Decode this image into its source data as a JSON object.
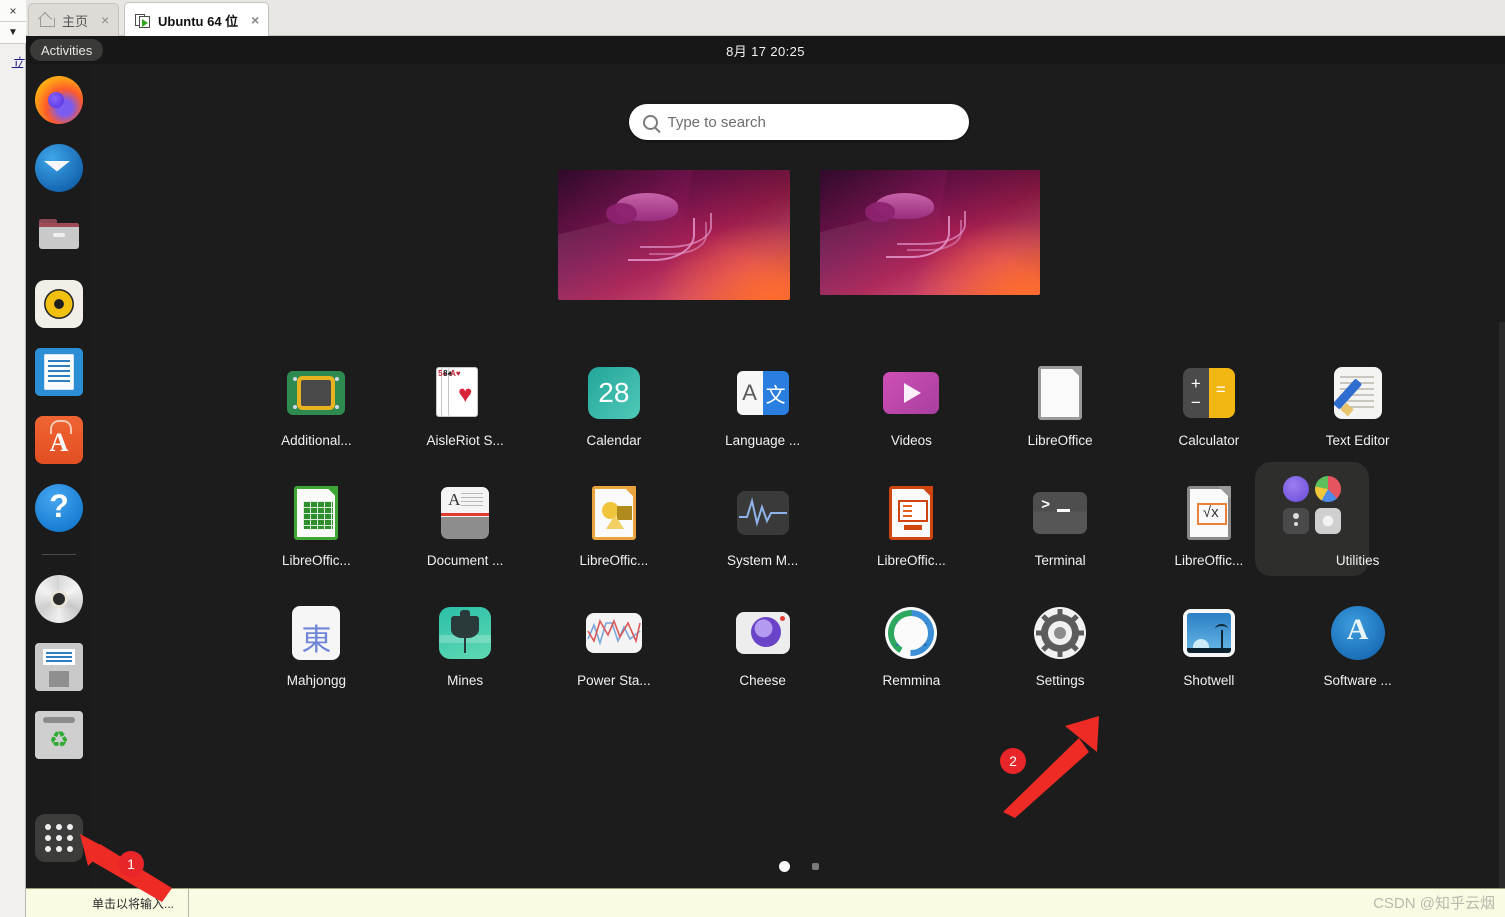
{
  "vmware": {
    "tabs": [
      {
        "label": "主页",
        "icon": "home-icon",
        "active": false
      },
      {
        "label": "Ubuntu 64 位",
        "icon": "vm-icon",
        "active": true
      }
    ],
    "close_glyph": "×",
    "left_rail": {
      "close_glyph": "×",
      "dropdown_glyph": "▼",
      "vertical_text": "立"
    },
    "statusbar": {
      "text": "单击以将输入..."
    }
  },
  "watermark": "CSDN @知乎云烟",
  "topbar": {
    "activities_label": "Activities",
    "clock": "8月 17  20:25"
  },
  "search": {
    "placeholder": "Type to search",
    "icon": "search-icon"
  },
  "workspaces": [
    {
      "name": "workspace-1",
      "wallpaper": "ubuntu-jammy-jellyfish"
    },
    {
      "name": "workspace-2",
      "wallpaper": "ubuntu-jammy-jellyfish"
    }
  ],
  "dock": {
    "items": [
      {
        "label": "Firefox",
        "icon": "firefox-icon"
      },
      {
        "label": "Thunderbird Mail",
        "icon": "thunderbird-icon"
      },
      {
        "label": "Files",
        "icon": "files-icon"
      },
      {
        "label": "Rhythmbox",
        "icon": "rhythmbox-icon"
      },
      {
        "label": "LibreOffice Writer",
        "icon": "libreoffice-writer-icon"
      },
      {
        "label": "Ubuntu Software",
        "icon": "ubuntu-software-icon"
      },
      {
        "label": "Help",
        "icon": "help-icon"
      },
      {
        "label": "CD/DVD Drive",
        "icon": "disc-icon"
      },
      {
        "label": "Disk Image",
        "icon": "floppy-icon"
      },
      {
        "label": "Trash",
        "icon": "trash-icon"
      }
    ],
    "show_apps_label": "Show Applications"
  },
  "apps": [
    {
      "label": "Additional...",
      "icon": "additional-drivers-icon"
    },
    {
      "label": "AisleRiot S...",
      "icon": "aisleriot-solitaire-icon"
    },
    {
      "label": "Calendar",
      "icon": "calendar-icon",
      "icon_text": "28"
    },
    {
      "label": "Language ...",
      "icon": "language-support-icon",
      "icon_text_left": "A",
      "icon_text_right": "文"
    },
    {
      "label": "Videos",
      "icon": "videos-icon"
    },
    {
      "label": "LibreOffice",
      "icon": "libreoffice-start-center-icon"
    },
    {
      "label": "Calculator",
      "icon": "calculator-icon"
    },
    {
      "label": "Text Editor",
      "icon": "text-editor-icon"
    },
    {
      "label": "LibreOffic...",
      "icon": "libreoffice-calc-icon"
    },
    {
      "label": "Document ...",
      "icon": "document-scanner-icon"
    },
    {
      "label": "LibreOffic...",
      "icon": "libreoffice-draw-icon"
    },
    {
      "label": "System M...",
      "icon": "system-monitor-icon"
    },
    {
      "label": "LibreOffic...",
      "icon": "libreoffice-impress-icon"
    },
    {
      "label": "Terminal",
      "icon": "terminal-icon"
    },
    {
      "label": "LibreOffic...",
      "icon": "libreoffice-math-icon"
    },
    {
      "label": "Utilities",
      "icon": "utilities-folder-icon",
      "is_folder": true
    },
    {
      "label": "Mahjongg",
      "icon": "mahjongg-icon",
      "icon_text": "東"
    },
    {
      "label": "Mines",
      "icon": "mines-icon"
    },
    {
      "label": "Power Sta...",
      "icon": "power-statistics-icon"
    },
    {
      "label": "Cheese",
      "icon": "cheese-icon"
    },
    {
      "label": "Remmina",
      "icon": "remmina-icon"
    },
    {
      "label": "Settings",
      "icon": "settings-icon"
    },
    {
      "label": "Shotwell",
      "icon": "shotwell-icon"
    },
    {
      "label": "Software ...",
      "icon": "ubuntu-software-center-icon"
    }
  ],
  "page_indicator": {
    "pages": 2,
    "current": 1
  },
  "annotations": [
    {
      "number": "1",
      "target": "show-applications-button",
      "color": "#e8262a"
    },
    {
      "number": "2",
      "target": "settings-app-icon",
      "color": "#e8262a"
    }
  ]
}
